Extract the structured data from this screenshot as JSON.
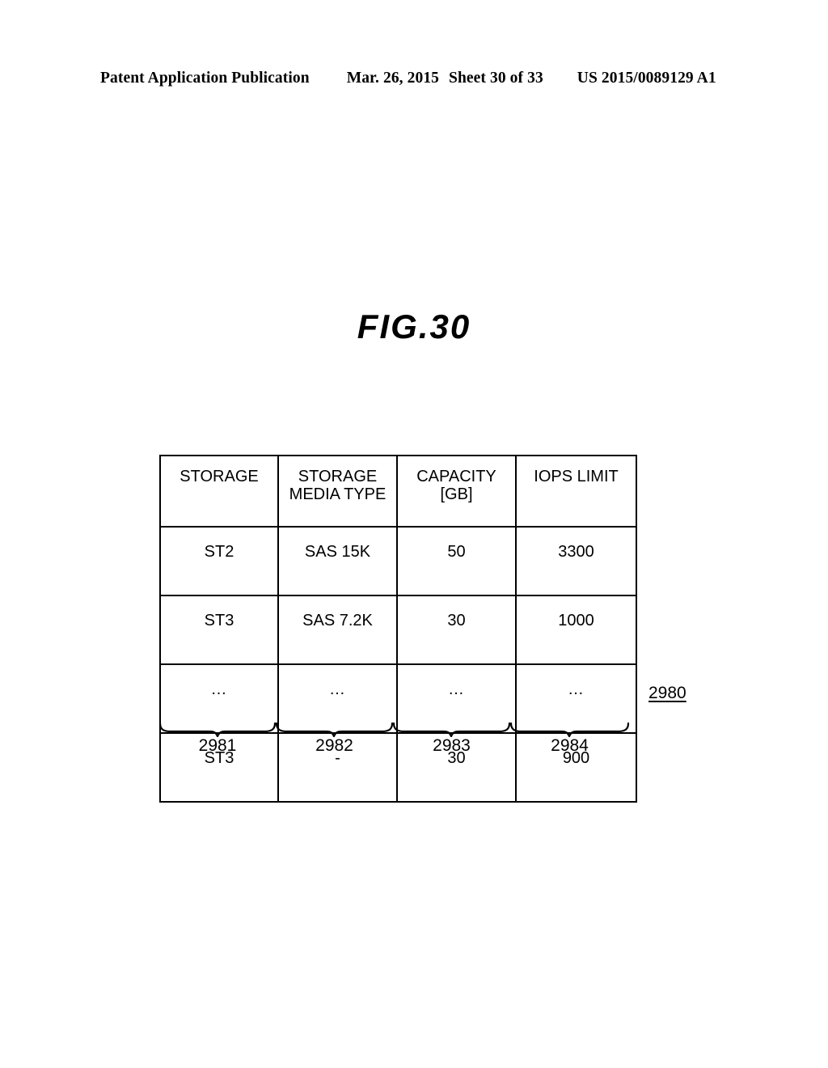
{
  "header": {
    "publication": "Patent Application Publication",
    "date": "Mar. 26, 2015",
    "sheet": "Sheet 30 of 33",
    "doc_number": "US 2015/0089129 A1"
  },
  "figure": {
    "title": "FIG.30",
    "table_ref": "2980"
  },
  "table": {
    "columns": [
      {
        "line1": "STORAGE",
        "line2": ""
      },
      {
        "line1": "STORAGE",
        "line2": "MEDIA TYPE"
      },
      {
        "line1": "CAPACITY",
        "line2": "[GB]"
      },
      {
        "line1": "IOPS LIMIT",
        "line2": ""
      }
    ],
    "rows": [
      {
        "storage": "ST2",
        "media_type": "SAS 15K",
        "capacity": "50",
        "iops_limit": "3300"
      },
      {
        "storage": "ST3",
        "media_type": "SAS 7.2K",
        "capacity": "30",
        "iops_limit": "1000"
      },
      {
        "storage": "…",
        "media_type": "…",
        "capacity": "…",
        "iops_limit": "…"
      },
      {
        "storage": "ST3",
        "media_type": "-",
        "capacity": "30",
        "iops_limit": "900"
      }
    ],
    "column_refs": [
      "2981",
      "2982",
      "2983",
      "2984"
    ]
  },
  "colors": {
    "ink": "#000000",
    "paper": "#ffffff"
  }
}
